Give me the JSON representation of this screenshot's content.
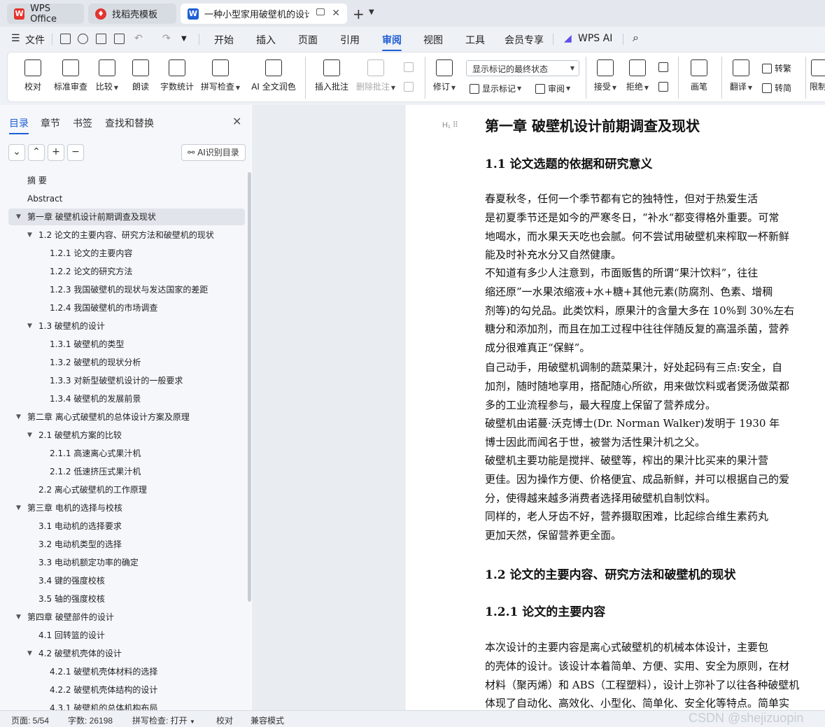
{
  "tabs": [
    {
      "label": "WPS Office",
      "icon": "wps-logo-icon"
    },
    {
      "label": "找稻壳模板",
      "icon": "docer-logo-icon"
    },
    {
      "label": "一种小型家用破壁机的设计 论",
      "icon": "word-doc-icon"
    }
  ],
  "menu": {
    "file": "文件",
    "items": [
      "开始",
      "插入",
      "页面",
      "引用",
      "审阅",
      "视图",
      "工具",
      "会员专享"
    ],
    "active": "审阅",
    "wps_ai": "WPS AI"
  },
  "ribbon": {
    "proofread": "校对",
    "std_review": "标准审查",
    "compare": "比较",
    "read_aloud": "朗读",
    "word_count": "字数统计",
    "spell_check": "拼写检查",
    "ai_polish": "AI 全文润色",
    "insert_comment": "插入批注",
    "delete_comment": "删除批注",
    "revise": "修订",
    "markup_mode": "显示标记的最终状态",
    "show_markup": "显示标记",
    "review": "审阅",
    "accept": "接受",
    "reject": "拒绝",
    "pen": "画笔",
    "translate": "翻译",
    "to_traditional": "转繁",
    "to_simplified": "转简",
    "restrict": "限制"
  },
  "sidebar": {
    "tabs": [
      "目录",
      "章节",
      "书签",
      "查找和替换"
    ],
    "active_tab": "目录",
    "ai_toc": "AI识别目录",
    "toc": [
      {
        "label": "摘    要",
        "level": 1,
        "arrow": false
      },
      {
        "label": "Abstract",
        "level": 1,
        "arrow": false
      },
      {
        "label": "第一章  破壁机设计前期调查及现状",
        "level": 1,
        "arrow": true,
        "selected": true
      },
      {
        "label": "1.2 论文的主要内容、研究方法和破壁机的现状",
        "level": 2,
        "arrow": true
      },
      {
        "label": "1.2.1 论文的主要内容",
        "level": 3,
        "arrow": false
      },
      {
        "label": "1.2.2 论文的研究方法",
        "level": 3,
        "arrow": false
      },
      {
        "label": "1.2.3 我国破壁机的现状与发达国家的差距",
        "level": 3,
        "arrow": false
      },
      {
        "label": "1.2.4 我国破壁机的市场调查",
        "level": 3,
        "arrow": false
      },
      {
        "label": "1.3  破壁机的设计",
        "level": 2,
        "arrow": true
      },
      {
        "label": "1.3.1 破壁机的类型",
        "level": 3,
        "arrow": false
      },
      {
        "label": "1.3.2  破壁机的现状分析",
        "level": 3,
        "arrow": false
      },
      {
        "label": "1.3.3 对新型破壁机设计的一般要求",
        "level": 3,
        "arrow": false
      },
      {
        "label": "1.3.4  破壁机的发展前景",
        "level": 3,
        "arrow": false
      },
      {
        "label": "第二章  离心式破壁机的总体设计方案及原理",
        "level": 1,
        "arrow": true
      },
      {
        "label": "2.1  破壁机方案的比较",
        "level": 2,
        "arrow": true
      },
      {
        "label": "2.1.1 高速离心式果汁机",
        "level": 3,
        "arrow": false
      },
      {
        "label": "2.1.2  低速挤压式果汁机",
        "level": 3,
        "arrow": false
      },
      {
        "label": "2.2 离心式破壁机的工作原理",
        "level": 2,
        "arrow": false
      },
      {
        "label": "第三章  电机的选择与校核",
        "level": 1,
        "arrow": true
      },
      {
        "label": "3.1  电动机的选择要求",
        "level": 2,
        "arrow": false
      },
      {
        "label": "3.2  电动机类型的选择",
        "level": 2,
        "arrow": false
      },
      {
        "label": "3.3  电动机额定功率的确定",
        "level": 2,
        "arrow": false
      },
      {
        "label": "3.4  键的强度校核",
        "level": 2,
        "arrow": false
      },
      {
        "label": "3.5  轴的强度校核",
        "level": 2,
        "arrow": false
      },
      {
        "label": "第四章     破壁部件的设计",
        "level": 1,
        "arrow": true
      },
      {
        "label": "4.1  回转篮的设计",
        "level": 2,
        "arrow": false
      },
      {
        "label": "4.2 破壁机壳体的设计",
        "level": 2,
        "arrow": true
      },
      {
        "label": "4.2.1  破壁机壳体材料的选择",
        "level": 3,
        "arrow": false
      },
      {
        "label": "4.2.2 破壁机壳体结构的设计",
        "level": 3,
        "arrow": false
      },
      {
        "label": "4.3.1 破壁机的总体机构布局",
        "level": 3,
        "arrow": false
      }
    ]
  },
  "document": {
    "chapter_title": "第一章  破壁机设计前期调查及现状",
    "section_1_1": "1.1  论文选题的依据和研究意义",
    "para1": [
      "      春夏秋冬，任何一个季节都有它的独特性，但对于热爱生活",
      "是初夏季节还是如今的严寒冬日，“补水“都变得格外重要。可常",
      "地喝水，而水果天天吃也会腻。何不尝试用破壁机来榨取一杯新鲜",
      "能及时补充水分又自然健康。"
    ],
    "para2": [
      "     不知道有多少人注意到，市面贩售的所谓“果汁饮料”，往往",
      "缩还原”一水果浓缩液+水+糖+其他元素(防腐剂、色素、增稠",
      "剂等)的勾兑品。此类饮料，原果汁的含量大多在 10%到 30%左右",
      "糖分和添加剂，而且在加工过程中往往伴随反复的高温杀菌，营养",
      "成分很难真正“保鲜”。"
    ],
    "para3": [
      "自己动手，用破壁机调制的蔬菜果汁，好处起码有三点:安全，自",
      "加剂，随时随地享用，搭配随心所欲，用来做饮料或者煲汤做菜都",
      "多的工业流程参与，最大程度上保留了营养成分。"
    ],
    "para4": [
      "     破壁机由诺蔓·沃克博士(Dr. Norman Walker)发明于 1930 年",
      "博士因此而闻名于世，被誉为活性果汁机之父。"
    ],
    "para5": [
      "     破壁机主要功能是搅拌、破壁等，榨出的果汁比买来的果汁营",
      "更佳。因为操作方便、价格便宜、成品新鲜，并可以根据自己的爱",
      "分，使得越来越多消费者选择用破壁机自制饮料。"
    ],
    "para6": [
      "     同样的，老人牙齿不好，营养摄取困难，比起综合维生素药丸",
      "更加天然，保留营养更全面。"
    ],
    "section_1_2": "1.2 论文的主要内容、研究方法和破壁机的现状",
    "section_1_2_1": "1.2.1 论文的主要内容",
    "para7": [
      "     本次设计的主要内容是离心式破壁机的机械本体设计，主要包",
      "的壳体的设计。该设计本着简单、方便、实用、安全为原则，在材",
      "材料（聚丙烯）和 ABS（工程塑料），设计上弥补了以往各种破壁机",
      "体现了自动化、高效化、小型化、简单化、安全化等特点。简单实"
    ]
  },
  "status": {
    "page": "页面: 5/54",
    "words": "字数: 26198",
    "spell": "拼写检查: 打开",
    "proof": "校对",
    "compat": "兼容模式",
    "watermark": "CSDN @shejizuopin"
  },
  "colors": {
    "accent": "#1f5fd6",
    "wps_red": "#e3342f",
    "word_blue": "#1f5fd6"
  }
}
